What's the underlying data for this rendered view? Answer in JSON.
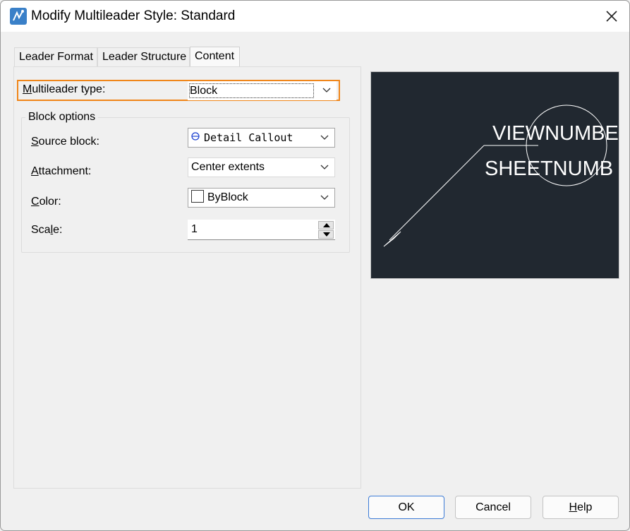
{
  "window": {
    "title": "Modify Multileader Style: Standard",
    "icon": "multileader-app-icon",
    "close_icon": "close-icon"
  },
  "tabs": [
    {
      "label": "Leader Format",
      "active": false
    },
    {
      "label": "Leader Structure",
      "active": false
    },
    {
      "label": "Content",
      "active": true
    }
  ],
  "content": {
    "multileader_type": {
      "label_prefix": "M",
      "label_rest": "ultileader type:",
      "value": "Block",
      "highlight_color": "#f0861a"
    },
    "block_options": {
      "title": "Block options",
      "source_block": {
        "label_prefix": "S",
        "label_rest": "ource block:",
        "value": "Detail Callout",
        "icon": "detail-callout-icon"
      },
      "attachment": {
        "label_prefix": "A",
        "label_rest": "ttachment:",
        "value": "Center extents"
      },
      "color": {
        "label_prefix": "C",
        "label_rest": "olor:",
        "value": "ByBlock",
        "swatch": "#ffffff"
      },
      "scale": {
        "label_before": "Sca",
        "label_ul": "l",
        "label_after": "e:",
        "value": "1"
      }
    }
  },
  "preview": {
    "line1": "VIEWNUMBE",
    "line2": "SHEETNUMB",
    "background": "#212830"
  },
  "buttons": {
    "ok": "OK",
    "cancel": "Cancel",
    "help_ul": "H",
    "help_rest": "elp"
  }
}
